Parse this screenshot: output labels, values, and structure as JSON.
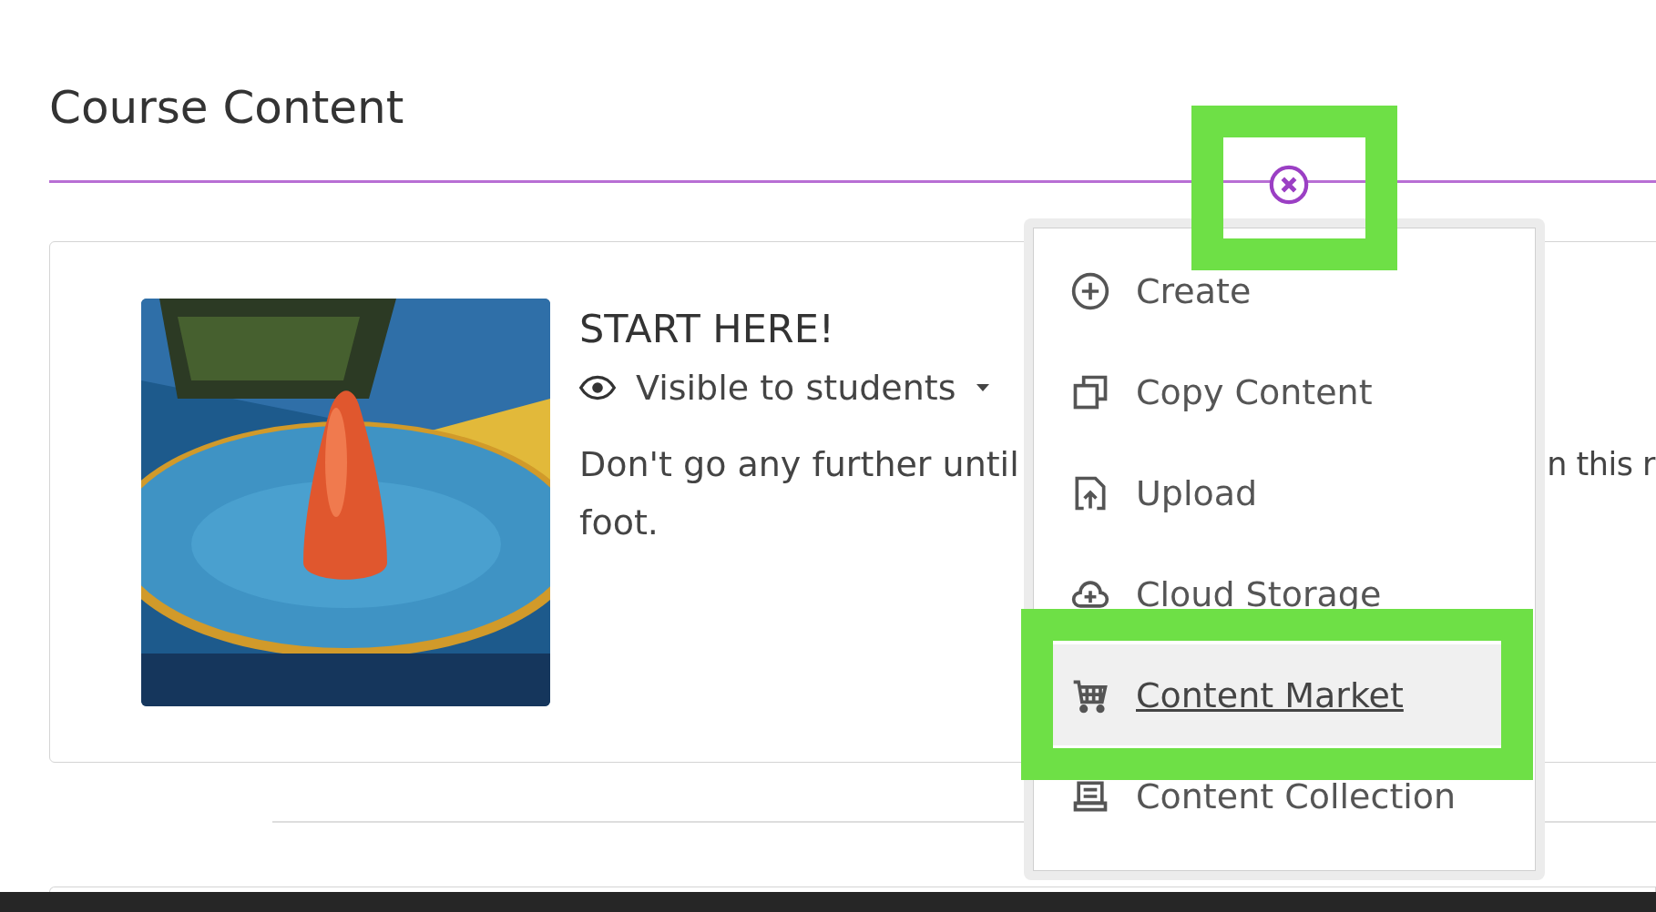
{
  "page": {
    "title": "Course Content"
  },
  "content_items": [
    {
      "title": "START HERE!",
      "visibility": "Visible to students",
      "description_line_1": "Don't go any further until",
      "description_line_1_end": "n this r",
      "description_line_2": "foot."
    }
  ],
  "add_menu": {
    "items": [
      {
        "kind": "create",
        "label": "Create",
        "selected": false
      },
      {
        "kind": "copy",
        "label": "Copy Content",
        "selected": false
      },
      {
        "kind": "upload",
        "label": "Upload",
        "selected": false
      },
      {
        "kind": "cloud",
        "label": "Cloud Storage",
        "selected": false
      },
      {
        "kind": "market",
        "label": "Content Market",
        "selected": true
      },
      {
        "kind": "collection",
        "label": "Content Collection",
        "selected": false
      }
    ]
  }
}
